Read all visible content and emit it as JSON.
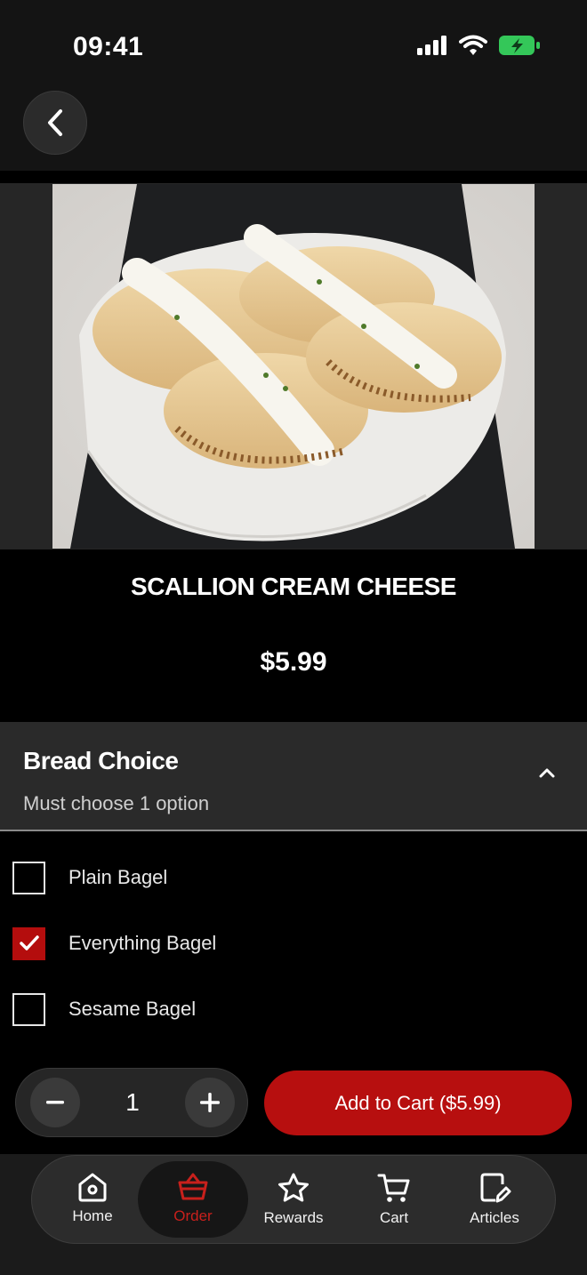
{
  "status": {
    "time": "09:41"
  },
  "product": {
    "name": "SCALLION CREAM CHEESE",
    "price": "$5.99"
  },
  "section": {
    "title": "Bread Choice",
    "subtitle": "Must choose 1 option"
  },
  "options": [
    {
      "label": "Plain Bagel",
      "checked": false
    },
    {
      "label": "Everything Bagel",
      "checked": true
    },
    {
      "label": "Sesame Bagel",
      "checked": false
    }
  ],
  "quantity": {
    "value": "1"
  },
  "cart_button": {
    "label": "Add to Cart ($5.99)"
  },
  "nav": {
    "items": [
      {
        "label": "Home",
        "icon": "home-icon",
        "active": false
      },
      {
        "label": "Order",
        "icon": "basket-icon",
        "active": true
      },
      {
        "label": "Rewards",
        "icon": "star-icon",
        "active": false
      },
      {
        "label": "Cart",
        "icon": "cart-icon",
        "active": false
      },
      {
        "label": "Articles",
        "icon": "article-edit-icon",
        "active": false
      }
    ]
  },
  "colors": {
    "accent": "#b70f0f",
    "background": "#000000",
    "battery": "#34c759"
  }
}
